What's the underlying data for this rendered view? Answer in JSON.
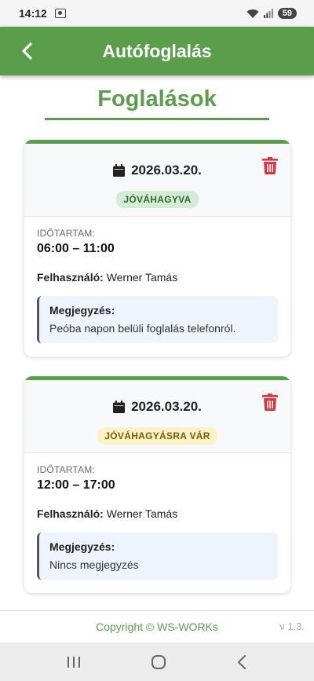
{
  "status_bar": {
    "time": "14:12",
    "battery": "59"
  },
  "header": {
    "title": "Autófoglalás"
  },
  "page": {
    "title": "Foglalások"
  },
  "bookings": [
    {
      "date": "2026.03.20.",
      "status": "JÓVÁHAGYVA",
      "duration_label": "IDŐTARTAM:",
      "time_range": "06:00 – 11:00",
      "user_label": "Felhasználó:",
      "user": "Werner Tamás",
      "note_label": "Megjegyzés:",
      "note": "Peóba napon belüli foglalás telefonról."
    },
    {
      "date": "2026.03.20.",
      "status": "JÓVÁHAGYÁSRA VÁR",
      "duration_label": "IDŐTARTAM:",
      "time_range": "12:00 – 17:00",
      "user_label": "Felhasználó:",
      "user": "Werner Tamás",
      "note_label": "Megjegyzés:",
      "note": "Nincs megjegyzés"
    }
  ],
  "footer": {
    "copyright": "Copyright © WS-WORKs",
    "version": "v 1.3."
  },
  "colors": {
    "brand": "#5a9e4c",
    "delete": "#d9363e",
    "approved_bg": "#d4ebd6",
    "pending_bg": "#fdf1c7"
  },
  "icons": [
    "back-arrow-icon",
    "calendar-icon",
    "trash-icon",
    "wifi-icon",
    "signal-icon",
    "screen-record-icon",
    "recent-apps-icon",
    "home-icon",
    "back-nav-icon"
  ]
}
